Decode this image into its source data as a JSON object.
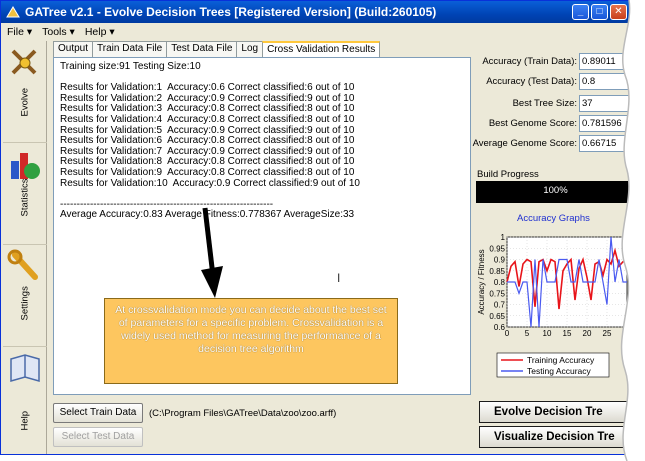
{
  "window": {
    "title": "GATree v2.1 - Evolve Decision Trees [Registered Version] (Build:260105)"
  },
  "menu": {
    "items": [
      "File ▾",
      "Tools ▾",
      "Help ▾"
    ]
  },
  "sidebar": {
    "items": [
      {
        "label": "Evolve",
        "icon": "evolve-icon"
      },
      {
        "label": "Statistics",
        "icon": "statistics-icon"
      },
      {
        "label": "Settings",
        "icon": "wrench-icon"
      },
      {
        "label": "Help",
        "icon": "help-book-icon"
      }
    ]
  },
  "tabs": [
    "Output",
    "Train Data File",
    "Test Data File",
    "Log",
    "Cross Validation Results"
  ],
  "active_tab": "Cross Validation Results",
  "results": {
    "lines": [
      "Training size:91 Testing Size:10",
      "",
      "Results for Validation:1  Accuracy:0.6 Correct classified:6 out of 10",
      "Results for Validation:2  Accuracy:0.9 Correct classified:9 out of 10",
      "Results for Validation:3  Accuracy:0.8 Correct classified:8 out of 10",
      "Results for Validation:4  Accuracy:0.8 Correct classified:8 out of 10",
      "Results for Validation:5  Accuracy:0.9 Correct classified:9 out of 10",
      "Results for Validation:6  Accuracy:0.8 Correct classified:8 out of 10",
      "Results for Validation:7  Accuracy:0.9 Correct classified:9 out of 10",
      "Results for Validation:8  Accuracy:0.8 Correct classified:8 out of 10",
      "Results for Validation:9  Accuracy:0.8 Correct classified:8 out of 10",
      "Results for Validation:10  Accuracy:0.9 Correct classified:9 out of 10",
      "",
      "----------------------------------------------------------------",
      "Average Accuracy:0.83 Average Fitness:0.778367 AverageSize:33"
    ]
  },
  "annotation": {
    "text": "At crossvalidation mode you can decide about the best set of parameters for a specific problem. Crossvalidation is a widely used method for measuring the performance of a decision tree algorithm"
  },
  "buttons": {
    "select_train": "Select Train Data",
    "select_test": "Select Test Data",
    "evolve": "Evolve Decision Tre",
    "visualize": "Visualize Decision Tre"
  },
  "train_path": "(C:\\Program Files\\GATree\\Data\\zoo\\zoo.arff)",
  "stats": [
    {
      "label": "Accuracy (Train Data):",
      "value": "0.89011"
    },
    {
      "label": "Accuracy (Test Data):",
      "value": "0.8"
    },
    {
      "label": "Best Tree Size:",
      "value": "37"
    },
    {
      "label": "Best Genome Score:",
      "value": "0.781596"
    },
    {
      "label": "Average Genome Score:",
      "value": "0.66715"
    }
  ],
  "progress": {
    "label": "Build Progress",
    "text": "100%",
    "fraction": 1.0
  },
  "graph_link": "Accuracy Graphs",
  "colors": {
    "train": "#e8141a",
    "test": "#4a5af0",
    "titlebar": "#0a5fd8"
  },
  "chart_data": {
    "type": "line",
    "ylabel": "Accuracy / Fitness",
    "xlabel": "",
    "xlim": [
      0,
      30
    ],
    "ylim": [
      0.6,
      1.0
    ],
    "yticks": [
      "1",
      "0.95",
      "0.9",
      "0.85",
      "0.8",
      "0.75",
      "0.7",
      "0.65",
      "0.6"
    ],
    "xticks": [
      "0",
      "5",
      "10",
      "15",
      "20",
      "25"
    ],
    "legend_position": "bottom",
    "series": [
      {
        "name": "Training Accuracy",
        "color": "#e8141a",
        "x": [
          0,
          1,
          2,
          3,
          4,
          5,
          6,
          7,
          8,
          9,
          10,
          11,
          12,
          13,
          14,
          15,
          16,
          17,
          18,
          19,
          20,
          21,
          22,
          23,
          24,
          25,
          26,
          27,
          28,
          29,
          30
        ],
        "y": [
          0.8,
          0.87,
          0.89,
          0.78,
          0.88,
          0.9,
          0.89,
          0.69,
          0.89,
          0.9,
          0.85,
          0.9,
          0.89,
          0.68,
          0.85,
          0.88,
          0.9,
          0.72,
          0.86,
          0.9,
          0.82,
          0.72,
          0.88,
          0.89,
          0.83,
          0.9,
          0.88,
          0.94,
          0.87,
          0.89,
          0.9
        ]
      },
      {
        "name": "Testing Accuracy",
        "color": "#4a5af0",
        "x": [
          0,
          1,
          2,
          3,
          4,
          5,
          6,
          7,
          8,
          9,
          10,
          11,
          12,
          13,
          14,
          15,
          16,
          17,
          18,
          19,
          20,
          21,
          22,
          23,
          24,
          25,
          26,
          27,
          28,
          29,
          30
        ],
        "y": [
          0.8,
          0.8,
          0.8,
          0.75,
          0.8,
          0.8,
          0.6,
          0.9,
          0.6,
          0.9,
          0.8,
          0.8,
          0.8,
          0.9,
          0.9,
          0.9,
          0.8,
          0.8,
          0.9,
          0.8,
          0.8,
          0.8,
          0.8,
          0.9,
          0.8,
          0.7,
          1.0,
          0.8,
          0.9,
          0.8,
          0.8
        ]
      }
    ]
  }
}
